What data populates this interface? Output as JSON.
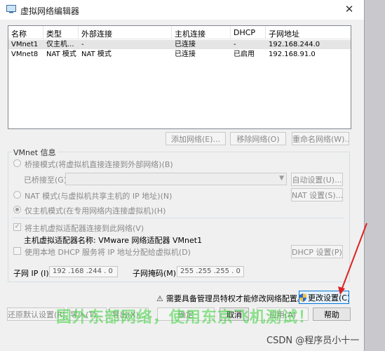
{
  "window": {
    "title": "虚拟网络编辑器",
    "close_glyph": "✕"
  },
  "network_list": {
    "columns": [
      "名称",
      "类型",
      "外部连接",
      "主机连接",
      "DHCP",
      "子网地址"
    ],
    "rows": [
      {
        "name": "VMnet1",
        "type": "仅主机...",
        "external": "-",
        "host": "已连接",
        "dhcp": "-",
        "subnet": "192.168.244.0"
      },
      {
        "name": "VMnet8",
        "type": "NAT 模式",
        "external": "NAT 模式",
        "host": "已连接",
        "dhcp": "已启用",
        "subnet": "192.168.91.0"
      }
    ]
  },
  "list_buttons": {
    "add": "添加网络(E)...",
    "remove": "移除网络(O)",
    "rename": "重命名网络(W)..."
  },
  "vmnet_info": {
    "legend": "VMnet 信息",
    "bridged_label": "桥接模式(将虚拟机直接连接到外部网络)(B)",
    "bridged_to_label": "已桥接至(G):",
    "auto_settings": "自动设置(U)...",
    "nat_label": "NAT 模式(与虚拟机共享主机的 IP 地址)(N)",
    "nat_settings": "NAT 设置(S)...",
    "hostonly_label": "仅主机模式(在专用网络内连接虚拟机)(H)",
    "connect_adapter_label": "将主机虚拟适配器连接到此网络(V)",
    "adapter_name_label": "主机虚拟适配器名称: VMware 网络适配器 VMnet1",
    "dhcp_label": "使用本地 DHCP 服务将 IP 地址分配给虚拟机(D)",
    "dhcp_settings": "DHCP 设置(P)...",
    "subnet_ip_label": "子网 IP (I):",
    "subnet_ip_value": "192 .168 .244 . 0",
    "subnet_mask_label": "子网掩码(M):",
    "subnet_mask_value": "255 .255 .255 . 0"
  },
  "admin_notice": {
    "text": "需要具备管理员特权才能修改网络配置。",
    "change_settings": "更改设置(C)"
  },
  "bottom_buttons": {
    "restore": "还原默认设置(R)",
    "import": "导入(T)...",
    "export": "导出(X)...",
    "ok": "确定",
    "cancel": "取消",
    "apply": "应用(A)",
    "help": "帮助"
  },
  "overlays": {
    "watermark": "国外东部网络，使用东京飞机测试！",
    "credit": "CSDN @程序员小十一"
  },
  "colors": {
    "annotation_arrow": "#e02020",
    "selection_row": "#e5e5e5",
    "primary_border": "#0078d7"
  }
}
